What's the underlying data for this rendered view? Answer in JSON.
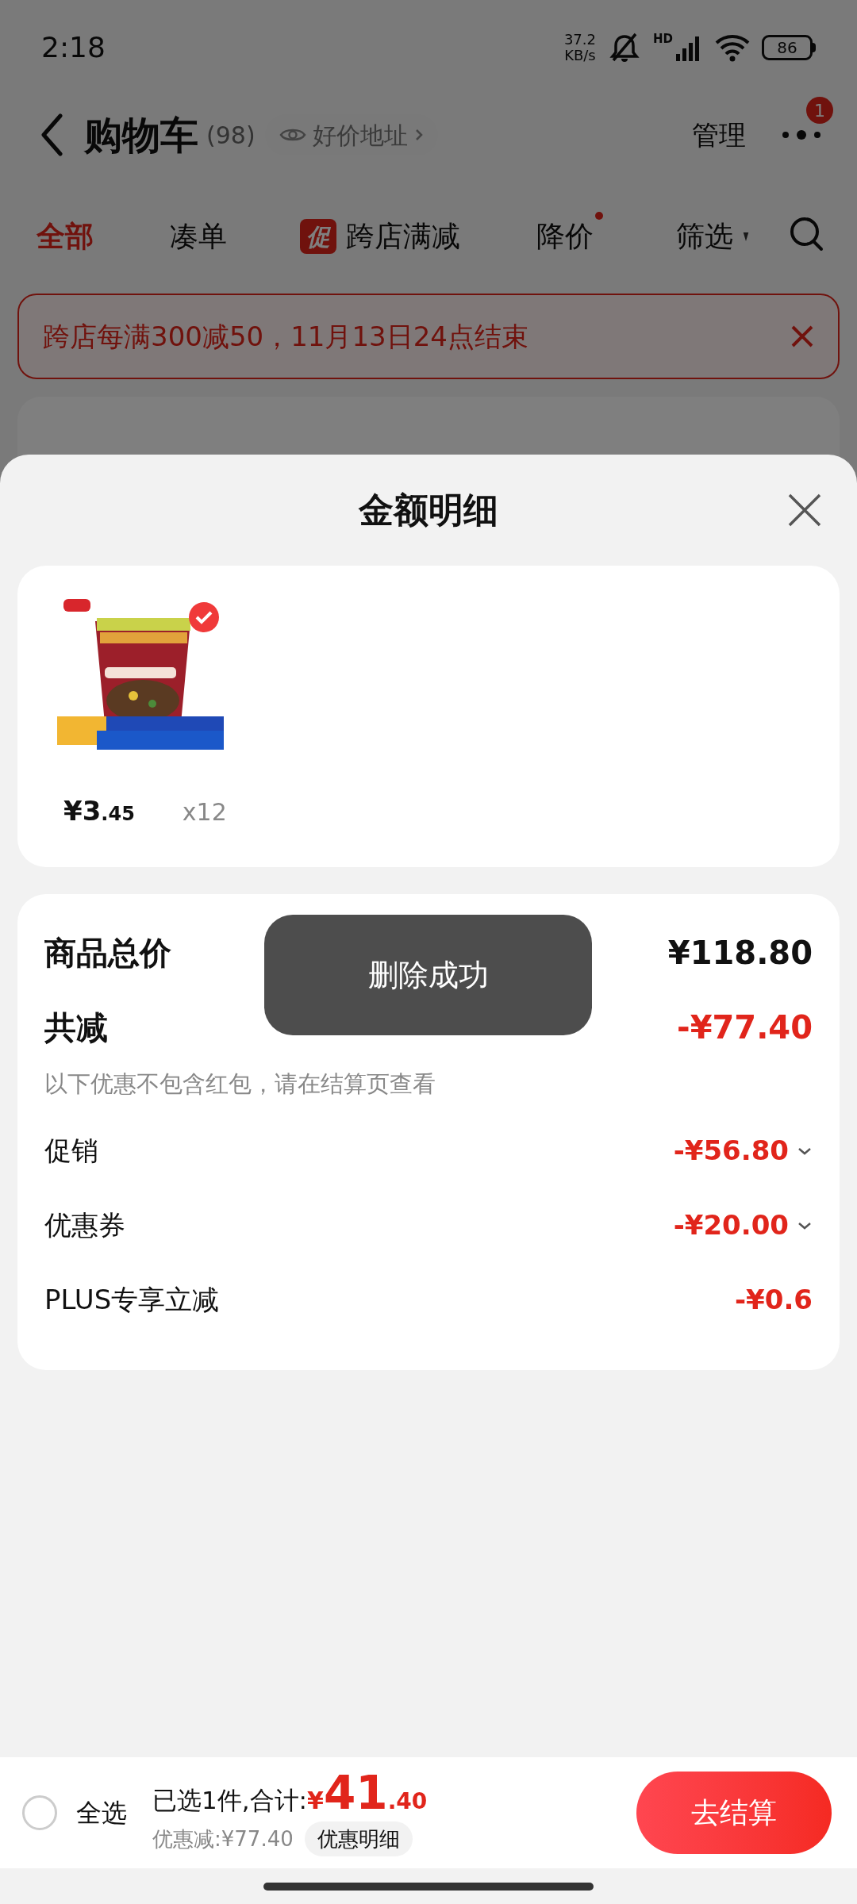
{
  "status_bar": {
    "time": "2:18",
    "speed_value": "37.2",
    "speed_unit": "KB/s",
    "network_label": "HD",
    "battery": "86"
  },
  "header": {
    "title": "购物车",
    "count": "(98)",
    "address_chip": "好价地址",
    "manage": "管理",
    "more_badge": "1"
  },
  "tabs": [
    {
      "label": "全部",
      "selected": true,
      "dot": false,
      "kind": "plain"
    },
    {
      "label": "凑单",
      "selected": false,
      "dot": false,
      "kind": "plain"
    },
    {
      "label": "跨店满减",
      "selected": false,
      "badge": "促",
      "dot": false,
      "kind": "badge"
    },
    {
      "label": "降价",
      "selected": false,
      "dot": true,
      "kind": "plain"
    },
    {
      "label": "筛选",
      "selected": false,
      "dot": false,
      "kind": "filter"
    }
  ],
  "promo_banner": {
    "text": "跨店每满300减50，11月13日24点结束"
  },
  "sheet": {
    "title": "金额明细",
    "items": [
      {
        "price_integer": "¥3",
        "price_decimal": ".45",
        "quantity": "x12",
        "selected": true
      }
    ],
    "summary": [
      {
        "kind": "total",
        "label": "商品总价",
        "value": "¥118.80"
      },
      {
        "kind": "reduction",
        "label": "共减",
        "value": "-¥77.40"
      },
      {
        "kind": "note",
        "label": "以下优惠不包含红包，请在结算页查看"
      },
      {
        "kind": "line",
        "label": "促销",
        "value": "-¥56.80",
        "chevron": true
      },
      {
        "kind": "line",
        "label": "优惠券",
        "value": "-¥20.00",
        "chevron": true
      },
      {
        "kind": "line",
        "label": "PLUS专享立减",
        "value": "-¥0.6",
        "chevron": false
      }
    ]
  },
  "toast": "删除成功",
  "bottom_bar": {
    "select_all": {
      "label": "全选",
      "checked": false
    },
    "selected_text": "已选1件,合计:",
    "currency": "¥",
    "total_integer": "41",
    "total_decimal": ".40",
    "discount": "优惠减:¥77.40",
    "details_button": "优惠明细",
    "checkout": "去结算"
  }
}
